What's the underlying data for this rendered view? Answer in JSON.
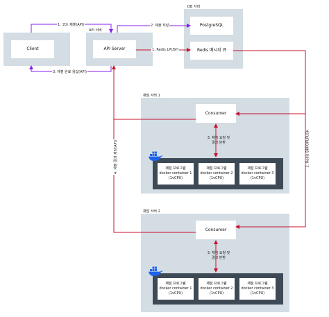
{
  "colors": {
    "wire": "#8a1df0",
    "wire_red": "#c8102e",
    "gray_box": "#d3dde3",
    "dark_box": "#3d4a55",
    "docker_blue": "#1d63ed"
  },
  "nodes": {
    "client": "Client",
    "api_server": "API Server",
    "api_server_group": "API 서버",
    "db_group": "DB 서버",
    "postgres": "PostgreSQL",
    "redis": "Redis 메시지 큐",
    "grading1_group": "채점 서버 1",
    "grading2_group": "채점 서버 2",
    "consumer": "Consumer"
  },
  "containers": [
    {
      "line1": "채점 프로그램",
      "line2": "docker container 1",
      "line3": "(1vCPU)"
    },
    {
      "line1": "채점 프로그램",
      "line2": "docker container 2",
      "line3": "(1vCPU)"
    },
    {
      "line1": "채점 프로그램",
      "line2": "docker container 3",
      "line3": "(1vCPU)"
    }
  ],
  "edges": {
    "submit_code": "1. 코드 제출(API)",
    "notify_done": "3. 채점 완료 응답(API)",
    "save": "2. 제출 저장",
    "lpush": "1. Redis LPUSH",
    "brpoplpush": "2. Redis BRPOPLPUSH",
    "save_result": "4. 채점 결과 저장(API)",
    "grade_req_line1": "3. 채점 요청 및",
    "grade_req_line2": "결과 반환"
  },
  "icons": {
    "docker": "docker-whale-icon"
  }
}
